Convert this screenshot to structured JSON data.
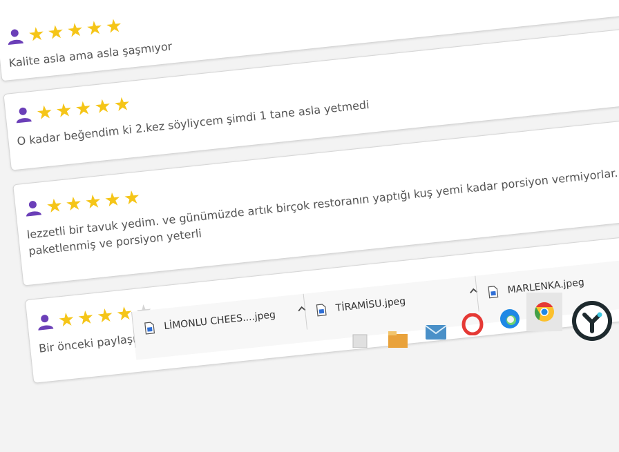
{
  "reviews": [
    {
      "stars": 5,
      "text": "Kalite asla ama asla şaşmıyor"
    },
    {
      "stars": 5,
      "text": "O kadar beğendim ki 2.kez söyliycem şimdi 1 tane asla yetmedi"
    },
    {
      "stars": 5,
      "text": "lezzetli bir tavuk yedim. ve günümüzde artık birçok restoranın yaptığı kuş yemi kadar porsiyon vermiyorlar. layıkıyla paketlenmiş ve porsiyon yeterli"
    },
    {
      "stars": 4,
      "text": "Bir önceki paylaşımımda sipariş... bu daha hazır geldi"
    }
  ],
  "star_glyph": "★",
  "colors": {
    "star_filled": "#f5c518",
    "star_empty": "#d4d4d4",
    "user_icon": "#6b3fb8",
    "comment_text": "#555555",
    "chrome_red": "#e53935",
    "chrome_yellow": "#fbc02d",
    "chrome_green": "#43a047",
    "edge_blue": "#1e88e5",
    "opera_red": "#e53935",
    "mail_blue": "#4a90c8",
    "badge_bg": "#1e2a2e"
  },
  "downloads": [
    {
      "name": "LİMONLU CHEES....jpeg"
    },
    {
      "name": "TİRAMİSU.jpeg"
    },
    {
      "name": "MARLENKA.jpeg"
    }
  ],
  "icons": {
    "user": "user-icon",
    "star": "star-icon",
    "file": "file-icon",
    "chevron": "chevron-up-icon",
    "mail": "mail-icon",
    "opera": "opera-icon",
    "edge": "edge-icon",
    "chrome": "chrome-icon",
    "badge": "app-logo-icon"
  }
}
